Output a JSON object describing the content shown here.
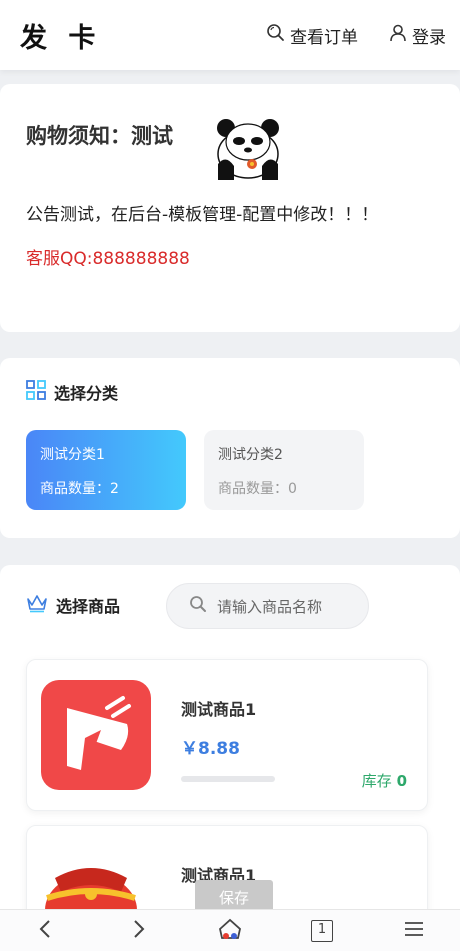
{
  "header": {
    "logo": "发 卡",
    "orders_label": "查看订单",
    "login_label": "登录"
  },
  "notice": {
    "title": "购物须知：测试",
    "text": "公告测试，在后台-模板管理-配置中修改！！！",
    "contact": "客服QQ:888888888"
  },
  "category_section": {
    "title": "选择分类",
    "items": [
      {
        "name": "测试分类1",
        "count_label": "商品数量：2",
        "active": true
      },
      {
        "name": "测试分类2",
        "count_label": "商品数量：0",
        "active": false
      }
    ]
  },
  "product_section": {
    "title": "选择商品",
    "search_placeholder": "请输入商品名称",
    "items": [
      {
        "name": "测试商品1",
        "price": "￥8.88",
        "stock_label": "库存",
        "stock_value": "0",
        "stock_level": 0
      },
      {
        "name": "测试商品1"
      }
    ]
  },
  "save_label": "保存",
  "colors": {
    "accent_blue": "#3d7ee0",
    "gradient_start": "#4a86f7",
    "gradient_end": "#43c9fc",
    "contact_red": "#d92b2b",
    "stock_green": "#2ea86b",
    "product_icon_red": "#f04848"
  },
  "icons": {
    "search": "search-icon",
    "user": "user-icon",
    "category": "category-icon",
    "crown": "crown-icon",
    "back": "back-icon",
    "forward": "forward-icon",
    "home": "home-icon",
    "tabs": "tabs-icon",
    "menu": "menu-icon"
  },
  "browser": {
    "tab_count": "1"
  }
}
